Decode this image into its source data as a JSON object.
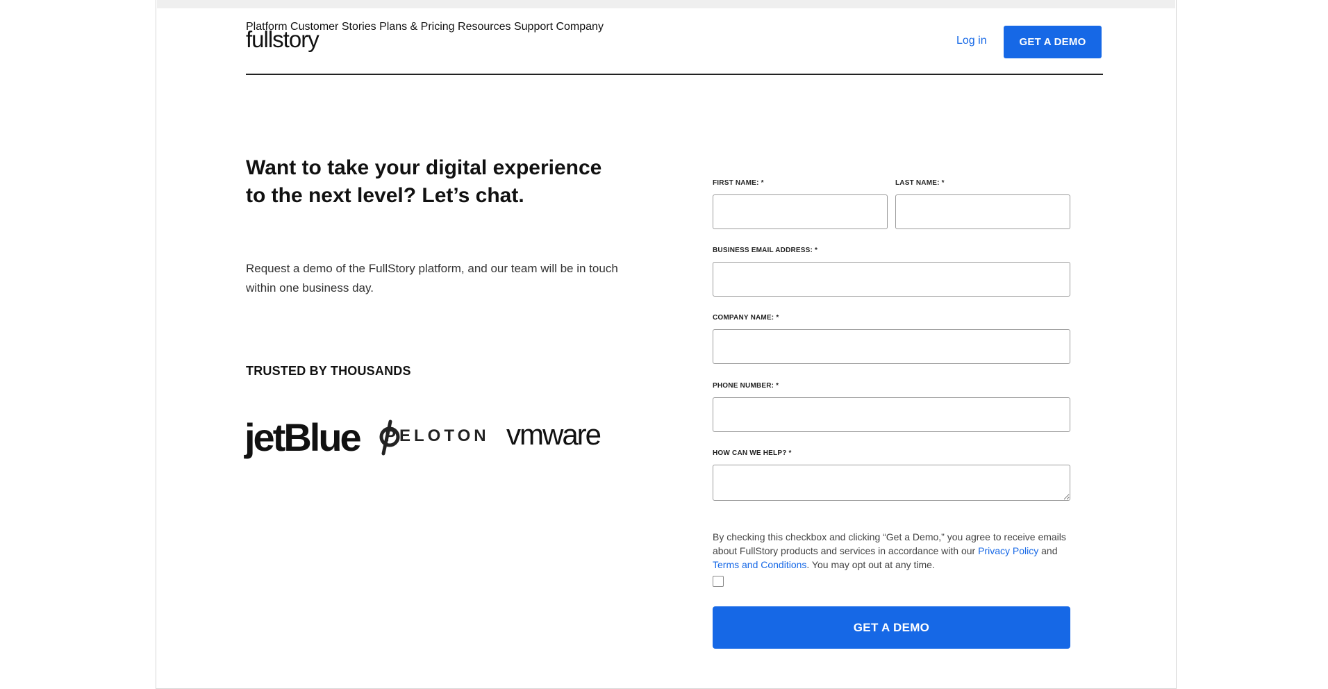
{
  "header": {
    "logo_text": "fullstory",
    "nav": [
      {
        "label": "Platform"
      },
      {
        "label": "Customer\nStories"
      },
      {
        "label": "Plans &\nPricing"
      },
      {
        "label": "Resources"
      },
      {
        "label": "Support"
      },
      {
        "label": "Company"
      }
    ],
    "login_label": "Log in",
    "cta_label": "GET A DEMO"
  },
  "hero": {
    "headline": "Want to take your digital experience to the next level? Let’s chat.",
    "subtext": "Request a demo of the FullStory platform, and our team will be in touch within one business day."
  },
  "trusted": {
    "heading": "TRUSTED BY THOUSANDS",
    "logos": [
      "jetBlue",
      "PELOTON",
      "vmware"
    ]
  },
  "form": {
    "first_name_label": "FIRST NAME: *",
    "last_name_label": "LAST NAME: *",
    "email_label": "BUSINESS EMAIL ADDRESS: *",
    "company_label": "COMPANY NAME: *",
    "phone_label": "PHONE NUMBER: *",
    "help_label": "HOW CAN WE HELP? *",
    "consent_part1": "By checking this checkbox and clicking “Get a Demo,” you agree to receive emails about FullStory products and services in accordance with our ",
    "privacy_link": "Privacy Policy",
    "consent_and": " and ",
    "terms_link": "Terms and Conditions",
    "consent_part2": ". You may opt out at any time.",
    "checkbox_checked": false,
    "submit_label": "GET A DEMO"
  },
  "colors": {
    "accent": "#1668e6"
  }
}
